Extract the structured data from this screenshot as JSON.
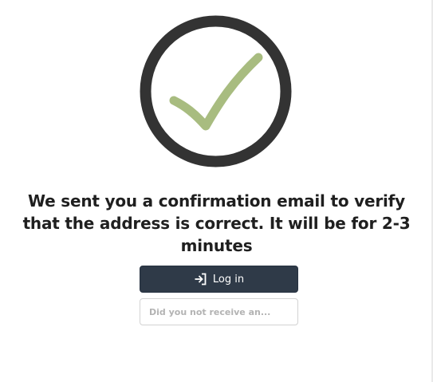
{
  "confirmation": {
    "icon": "checkmark-circle-icon",
    "icon_ring_color": "#333333",
    "icon_check_color": "#a8bc80",
    "message": "We sent you a confirmation email to verify that the address  is correct. It will be for 2-3 minutes"
  },
  "actions": {
    "login_icon": "login-arrow-icon",
    "login_label": "Log in",
    "login_button_color": "#2f3a48",
    "resend_label": "Did you not receive an..."
  }
}
